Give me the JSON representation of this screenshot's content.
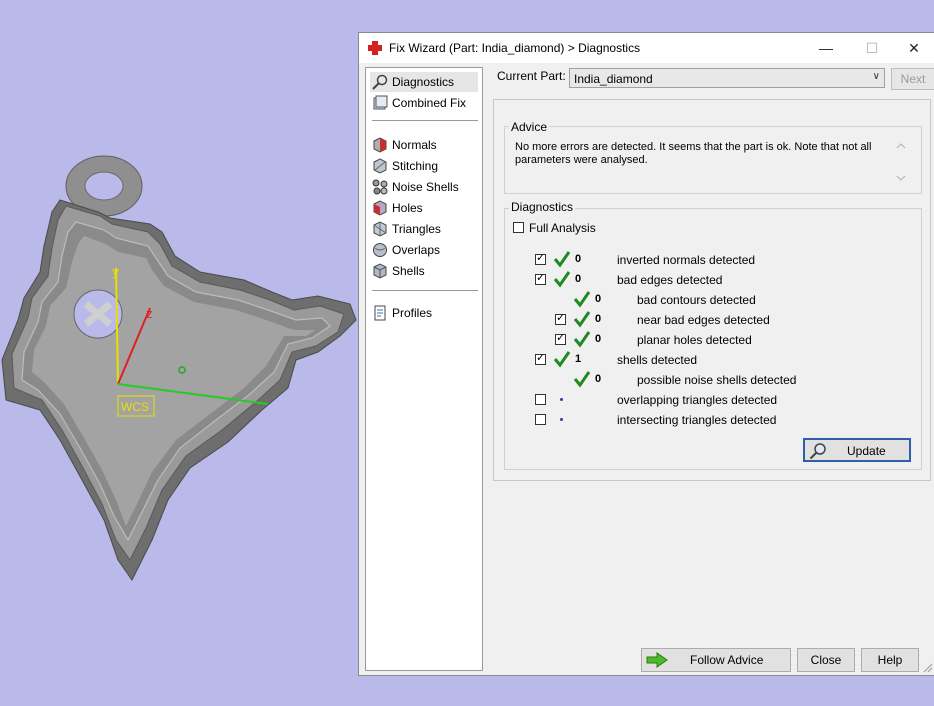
{
  "window": {
    "title": "Fix Wizard (Part: India_diamond) > Diagnostics",
    "minimize": "—",
    "maximize": "☐",
    "close": "✕"
  },
  "viewport": {
    "wcs_label": "WCS",
    "axis_y": "y",
    "axis_z": "z"
  },
  "nav": {
    "items": [
      {
        "label": "Diagnostics",
        "icon": "magnifier-icon",
        "selected": true
      },
      {
        "label": "Combined Fix",
        "icon": "combined-fix-icon"
      },
      {
        "label": "Normals",
        "icon": "normals-icon"
      },
      {
        "label": "Stitching",
        "icon": "stitching-icon"
      },
      {
        "label": "Noise Shells",
        "icon": "noise-shells-icon"
      },
      {
        "label": "Holes",
        "icon": "holes-icon"
      },
      {
        "label": "Triangles",
        "icon": "triangles-icon"
      },
      {
        "label": "Overlaps",
        "icon": "overlaps-icon"
      },
      {
        "label": "Shells",
        "icon": "shells-icon"
      },
      {
        "label": "Profiles",
        "icon": "profiles-icon"
      }
    ]
  },
  "top": {
    "current_part_label": "Current Part:",
    "current_part_value": "India_diamond",
    "next_label": "Next"
  },
  "advice": {
    "title": "Advice",
    "text": "No more errors are detected. It seems that the part is ok. Note that not all parameters were analysed."
  },
  "diagnostics": {
    "title": "Diagnostics",
    "full_analysis_label": "Full Analysis",
    "full_analysis_checked": false,
    "rows": [
      {
        "count": "0",
        "label": "inverted normals detected",
        "checkbox": true,
        "checked": true,
        "status": "ok"
      },
      {
        "count": "0",
        "label": "bad edges detected",
        "checkbox": true,
        "checked": true,
        "status": "ok"
      },
      {
        "count": "0",
        "label": "bad contours detected",
        "checkbox": false,
        "checked": false,
        "status": "ok"
      },
      {
        "count": "0",
        "label": "near bad edges detected",
        "checkbox": true,
        "checked": true,
        "status": "ok"
      },
      {
        "count": "0",
        "label": "planar holes detected",
        "checkbox": true,
        "checked": true,
        "status": "ok"
      },
      {
        "count": "1",
        "label": "shells detected",
        "checkbox": true,
        "checked": true,
        "status": "ok"
      },
      {
        "count": "0",
        "label": "possible noise shells detected",
        "checkbox": false,
        "checked": false,
        "status": "ok"
      },
      {
        "count": "",
        "label": "overlapping triangles detected",
        "checkbox": true,
        "checked": false,
        "status": "not-run"
      },
      {
        "count": "",
        "label": "intersecting triangles detected",
        "checkbox": true,
        "checked": false,
        "status": "not-run"
      }
    ],
    "update_label": "Update"
  },
  "footer": {
    "follow_advice_label": "Follow Advice",
    "close_label": "Close",
    "help_label": "Help"
  },
  "colors": {
    "viewport_bg": "#b9baea",
    "ok_check": "#1f8a1f",
    "accent_border": "#2f5fa8",
    "x_axis": "#22cc22",
    "y_axis": "#e8e000",
    "z_axis": "#dd2222"
  }
}
